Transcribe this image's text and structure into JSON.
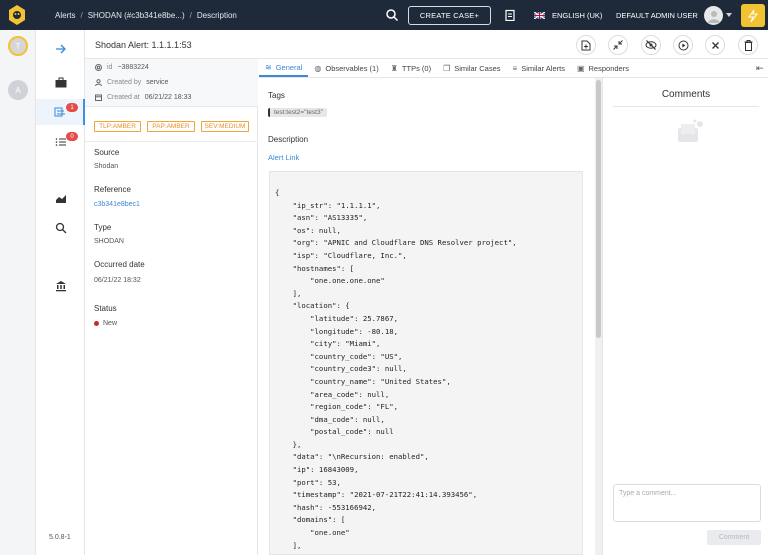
{
  "topbar": {
    "breadcrumb": [
      "Alerts",
      "SHODAN (#c3b341e8be...)",
      "Description"
    ],
    "create_case_label": "CREATE CASE+",
    "language_label": "ENGLISH (UK)",
    "user_label": "DEFAULT ADMIN USER"
  },
  "sidebar": {
    "org_avatars": [
      "T",
      "A"
    ],
    "badges": {
      "alerts": "1",
      "tasks": "0"
    },
    "version": "5.0.8-1"
  },
  "alert": {
    "title": "Shodan Alert: 1.1.1.1:53"
  },
  "details": {
    "id_label": "id",
    "id_value": "~3883224",
    "created_by_label": "Created by",
    "created_by_value": "service",
    "created_at_label": "Created at",
    "created_at_value": "06/21/22 18:33",
    "tags": [
      "TLP:AMBER",
      "PAP:AMBER",
      "SEV:MEDIUM"
    ],
    "source_label": "Source",
    "source_value": "Shodan",
    "reference_label": "Reference",
    "reference_value": "c3b341e8bec1",
    "type_label": "Type",
    "type_value": "SHODAN",
    "occurred_label": "Occurred date",
    "occurred_value": "06/21/22 18:32",
    "status_label": "Status",
    "status_value": "New"
  },
  "tabs": [
    "General",
    "Observables (1)",
    "TTPs (0)",
    "Similar Cases",
    "Similar Alerts",
    "Responders"
  ],
  "general": {
    "tags_label": "Tags",
    "tag_value": "test:test2=\"test3\"",
    "description_label": "Description",
    "alert_link": "Alert Link",
    "code": "{\n    \"ip_str\": \"1.1.1.1\",\n    \"asn\": \"AS13335\",\n    \"os\": null,\n    \"org\": \"APNIC and Cloudflare DNS Resolver project\",\n    \"isp\": \"Cloudflare, Inc.\",\n    \"hostnames\": [\n        \"one.one.one.one\"\n    ],\n    \"location\": {\n        \"latitude\": 25.7867,\n        \"longitude\": -80.18,\n        \"city\": \"Miami\",\n        \"country_code\": \"US\",\n        \"country_code3\": null,\n        \"country_name\": \"United States\",\n        \"area_code\": null,\n        \"region_code\": \"FL\",\n        \"dma_code\": null,\n        \"postal_code\": null\n    },\n    \"data\": \"\\nRecursion: enabled\",\n    \"ip\": 16843009,\n    \"port\": 53,\n    \"timestamp\": \"2021-07-21T22:41:14.393456\",\n    \"hash\": -553166942,\n    \"domains\": [\n        \"one.one\"\n    ],"
  },
  "comments": {
    "title": "Comments",
    "placeholder": "Type a comment...",
    "submit_label": "Comment"
  }
}
